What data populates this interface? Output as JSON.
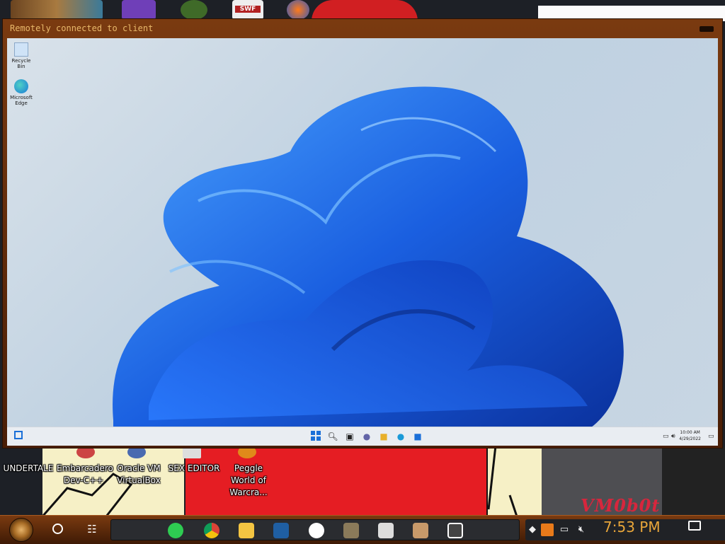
{
  "remote_window": {
    "title": "Remotely connected to client"
  },
  "remote_desktop": {
    "icons": [
      {
        "label": "Recycle Bin"
      },
      {
        "label": "Microsoft Edge"
      }
    ],
    "clock": {
      "time": "10:00 AM",
      "date": "4/29/2022"
    }
  },
  "host_desktop": {
    "icons": [
      {
        "label": "UNDERTALE"
      },
      {
        "label": "Embarcadero Dev-C++"
      },
      {
        "label": "Oracle VM VirtualBox"
      },
      {
        "label": "SEX EDITOR"
      },
      {
        "label": "Peggle World of Warcra..."
      }
    ],
    "top_icon_swf": "SWF",
    "brand_logo": "VM0b0t"
  },
  "host_taskbar": {
    "pinned": [
      {
        "name": "notes-icon",
        "color": "#2ecc52"
      },
      {
        "name": "chrome-icon",
        "color": "#db4437"
      },
      {
        "name": "file-explorer-icon",
        "color": "#f4c542"
      },
      {
        "name": "virtualbox-icon",
        "color": "#1f5fa3"
      },
      {
        "name": "help-icon",
        "color": "#ffffff"
      },
      {
        "name": "gimp-icon",
        "color": "#8a7a5a"
      },
      {
        "name": "skull-icon",
        "color": "#dddddd"
      },
      {
        "name": "portrait-icon",
        "color": "#c89a6a"
      },
      {
        "name": "unity-icon",
        "color": "#ffffff"
      }
    ],
    "clock": "7:53 PM"
  },
  "colors": {
    "window_frame": "#6a300c",
    "clock_text": "#e8a63a",
    "win11_blue": "#1a5fe0"
  }
}
